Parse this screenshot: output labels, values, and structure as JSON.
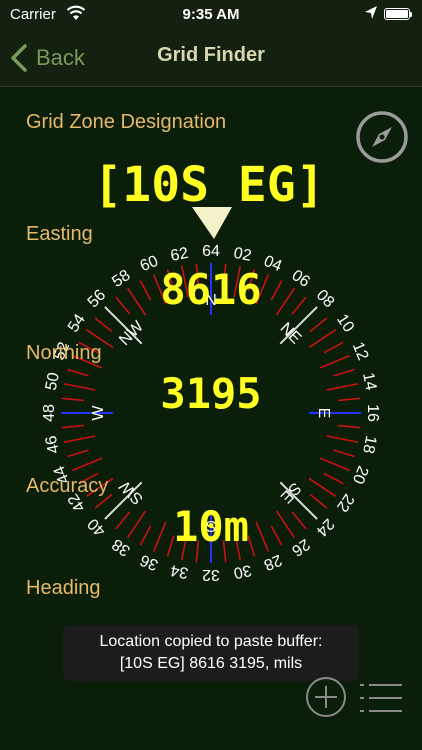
{
  "status_bar": {
    "carrier": "Carrier",
    "time": "9:35 AM"
  },
  "nav": {
    "back_label": "Back",
    "title": "Grid Finder"
  },
  "fields": {
    "gzd_label": "Grid Zone Designation",
    "gzd_value": "[10S EG]",
    "easting_label": "Easting",
    "easting_value": "8616",
    "northing_label": "Northing",
    "northing_value": "3195",
    "accuracy_label": "Accuracy",
    "accuracy_value": "10m",
    "heading_label": "Heading"
  },
  "compass_rose": {
    "heading_mils_hundreds": 64,
    "tick_labels": [
      "64",
      "02",
      "04",
      "06",
      "08",
      "10",
      "12",
      "14",
      "16",
      "18",
      "20",
      "22",
      "24",
      "26",
      "28",
      "30",
      "32",
      "34",
      "36",
      "38",
      "40",
      "42",
      "44",
      "46",
      "48",
      "50",
      "52",
      "54",
      "56",
      "58",
      "60",
      "62"
    ],
    "cardinals": [
      "N",
      "NE",
      "E",
      "SE",
      "S",
      "SW",
      "W",
      "NW"
    ],
    "tick_color": "#cc1111",
    "text_color": "#ffffff"
  },
  "toast": {
    "line1": "Location copied to paste buffer:",
    "line2": "[10S EG] 8616 3195,  mils"
  },
  "icons": {
    "compass": "compass-icon",
    "add": "plus-circle-icon",
    "list": "list-icon"
  },
  "colors": {
    "label": "#e6b86a",
    "value": "#ffff22",
    "background": "#0a1e0a",
    "nav_title": "#d8d8b0",
    "back": "#7a9a5a"
  }
}
